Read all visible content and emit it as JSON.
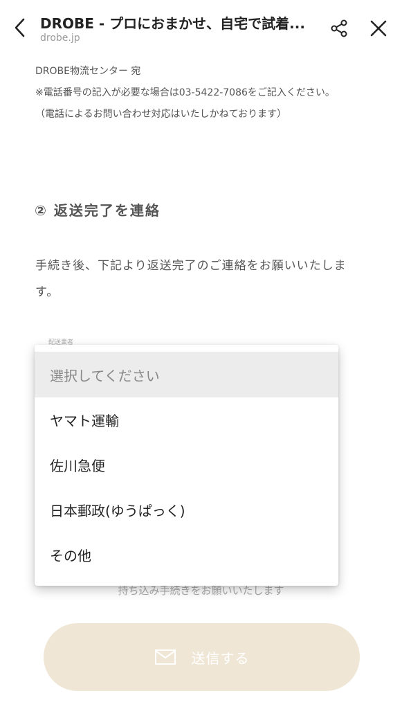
{
  "header": {
    "title": "DROBE - プロにおまかせ、自宅で試着...",
    "url": "drobe.jp"
  },
  "icons": {
    "back": "chevron-left-icon",
    "share": "share-icon",
    "close": "close-icon",
    "mail": "mail-icon"
  },
  "address": {
    "line1": "DROBE物流センター 宛",
    "line2": "※電話番号の記入が必要な場合は03-5422-7086をご記入ください。",
    "line3": "（電話によるお問い合わせ対応はいたしかねております）"
  },
  "section": {
    "title": "② 返送完了を連絡",
    "text": "手続き後、下記より返送完了のご連絡をお願いいたします。"
  },
  "field": {
    "label": "配送業者"
  },
  "dropdown": {
    "options": [
      "選択してください",
      "ヤマト運輸",
      "佐川急便",
      "日本郵政(ゆうぱっく)",
      "その他"
    ]
  },
  "behind": {
    "text": "持ち込み手続きをお願いいたします"
  },
  "button": {
    "send_label": "送信する"
  },
  "colors": {
    "button_bg": "#efe6d6",
    "selected_option_bg": "#ececec"
  }
}
